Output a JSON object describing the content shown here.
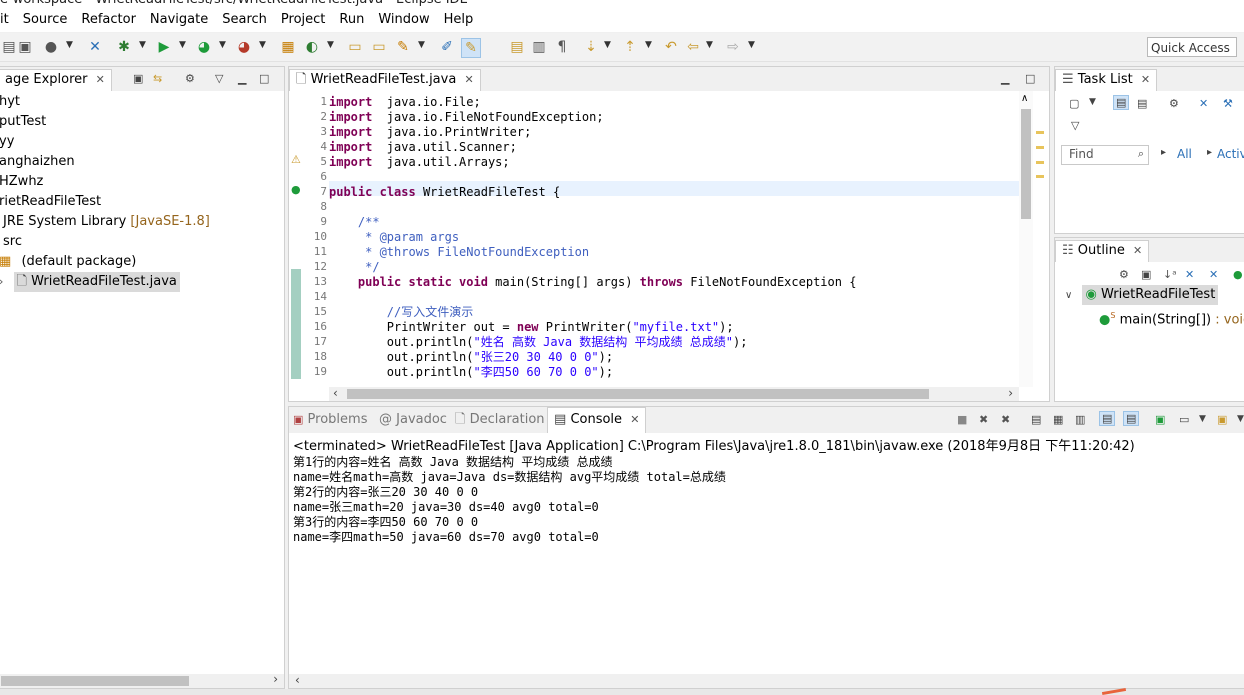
{
  "window_title": "e-workspace - WrietReadFileTest/src/WrietReadFileTest.java - Eclipse IDE",
  "menu": [
    "it",
    "Source",
    "Refactor",
    "Navigate",
    "Search",
    "Project",
    "Run",
    "Window",
    "Help"
  ],
  "quick_access": "Quick Access",
  "package_explorer": {
    "title": "age Explorer",
    "items": [
      {
        "label": "hyt"
      },
      {
        "label": "putTest"
      },
      {
        "label": "yy"
      },
      {
        "label": "anghaizhen"
      },
      {
        "label": "HZwhz"
      },
      {
        "label": "rietReadFileTest"
      },
      {
        "label": "JRE System Library",
        "suffix": "[JavaSE-1.8]"
      },
      {
        "label": "src"
      },
      {
        "label": "(default package)"
      },
      {
        "label": "WrietReadFileTest.java"
      }
    ]
  },
  "editor": {
    "tab": "WrietReadFileTest.java",
    "lines": [
      {
        "n": "1",
        "segs": [
          [
            "kw",
            "import"
          ],
          [
            "",
            "  java.io.File;"
          ]
        ]
      },
      {
        "n": "2",
        "segs": [
          [
            "kw",
            "import"
          ],
          [
            "",
            "  java.io.FileNotFoundException;"
          ]
        ]
      },
      {
        "n": "3",
        "segs": [
          [
            "kw",
            "import"
          ],
          [
            "",
            "  java.io.PrintWriter;"
          ]
        ]
      },
      {
        "n": "4",
        "segs": [
          [
            "kw",
            "import"
          ],
          [
            "",
            "  java.util.Scanner;"
          ]
        ]
      },
      {
        "n": "5",
        "segs": [
          [
            "kw",
            "import"
          ],
          [
            "",
            "  java.util.Arrays;"
          ]
        ]
      },
      {
        "n": "6",
        "segs": []
      },
      {
        "n": "7",
        "segs": [
          [
            "kw",
            "public"
          ],
          [
            "",
            " "
          ],
          [
            "kw",
            "class"
          ],
          [
            "",
            " WrietReadFileTest {"
          ]
        ]
      },
      {
        "n": "8",
        "segs": []
      },
      {
        "n": "9",
        "segs": [
          [
            "cm",
            "    /**"
          ]
        ]
      },
      {
        "n": "10",
        "segs": [
          [
            "cm",
            "     * @param args"
          ]
        ]
      },
      {
        "n": "11",
        "segs": [
          [
            "cm",
            "     * @throws FileNotFoundException"
          ]
        ]
      },
      {
        "n": "12",
        "segs": [
          [
            "cm",
            "     */"
          ]
        ]
      },
      {
        "n": "13",
        "segs": [
          [
            "",
            "    "
          ],
          [
            "kw",
            "public static void"
          ],
          [
            "",
            " main(String[] args) "
          ],
          [
            "kw",
            "throws"
          ],
          [
            "",
            " FileNotFoundException {"
          ]
        ]
      },
      {
        "n": "14",
        "segs": []
      },
      {
        "n": "15",
        "segs": [
          [
            "cm",
            "        //写入文件演示"
          ]
        ]
      },
      {
        "n": "16",
        "segs": [
          [
            "",
            "        PrintWriter out = "
          ],
          [
            "kw",
            "new"
          ],
          [
            "",
            " PrintWriter("
          ],
          [
            "str",
            "\"myfile.txt\""
          ],
          [
            "",
            ");"
          ]
        ]
      },
      {
        "n": "17",
        "segs": [
          [
            "",
            "        out.println("
          ],
          [
            "str",
            "\"姓名 高数 Java 数据结构 平均成绩 总成绩\""
          ],
          [
            "",
            ");"
          ]
        ]
      },
      {
        "n": "18",
        "segs": [
          [
            "",
            "        out.println("
          ],
          [
            "str",
            "\"张三20 30 40 0 0\""
          ],
          [
            "",
            ");"
          ]
        ]
      },
      {
        "n": "19",
        "segs": [
          [
            "",
            "        out.println("
          ],
          [
            "str",
            "\"李四50 60 70 0 0\""
          ],
          [
            "",
            ");"
          ]
        ]
      }
    ]
  },
  "task_list": {
    "title": "Task List",
    "find_placeholder": "Find",
    "all": "All",
    "activ": "Activ"
  },
  "outline": {
    "title": "Outline",
    "class_name": "WrietReadFileTest",
    "method": "main(String[])",
    "method_type": " : void"
  },
  "bottom_tabs": {
    "problems": "Problems",
    "javadoc": "Javadoc",
    "declaration": "Declaration",
    "console": "Console"
  },
  "console": {
    "header": "<terminated> WrietReadFileTest [Java Application] C:\\Program Files\\Java\\jre1.8.0_181\\bin\\javaw.exe (2018年9月8日 下午11:20:42)",
    "lines": [
      "第1行的内容=姓名 高数 Java 数据结构 平均成绩 总成绩",
      "name=姓名math=高数 java=Java ds=数据结构 avg平均成绩 total=总成绩",
      "第2行的内容=张三20 30 40 0 0",
      "name=张三math=20 java=30 ds=40 avg0 total=0",
      "第3行的内容=李四50 60 70 0 0",
      "name=李四math=50 java=60 ds=70 avg0 total=0"
    ]
  }
}
